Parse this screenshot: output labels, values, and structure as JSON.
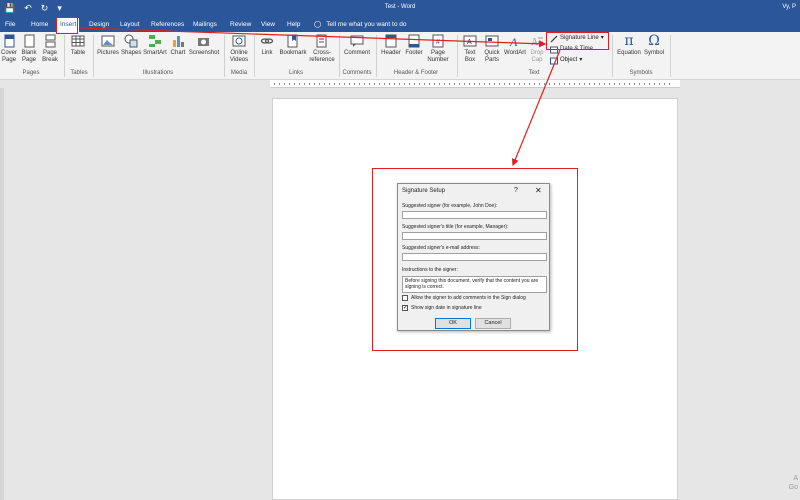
{
  "titlebar": {
    "title": "Test  -  Word",
    "user": "Vy, P"
  },
  "menu": {
    "tabs": [
      "File",
      "Home",
      "Insert",
      "Design",
      "Layout",
      "References",
      "Mailings",
      "Review",
      "View",
      "Help"
    ],
    "active_tab": "Insert",
    "tell_me": "Tell me what you want to do"
  },
  "ribbon": {
    "groups": {
      "pages": "Pages",
      "tables": "Tables",
      "illustrations": "Illustrations",
      "media": "Media",
      "links": "Links",
      "comments": "Comments",
      "header_footer": "Header & Footer",
      "text": "Text",
      "symbols": "Symbols"
    },
    "buttons": {
      "cover_page": "Cover\nPage",
      "blank_page": "Blank\nPage",
      "page_break": "Page\nBreak",
      "table": "Table",
      "pictures": "Pictures",
      "shapes": "Shapes",
      "smartart": "SmartArt",
      "chart": "Chart",
      "screenshot": "Screenshot",
      "online_videos": "Online\nVideos",
      "link": "Link",
      "bookmark": "Bookmark",
      "cross_reference": "Cross-\nreference",
      "comment": "Comment",
      "header": "Header",
      "footer": "Footer",
      "page_number": "Page\nNumber",
      "text_box": "Text\nBox",
      "quick_parts": "Quick\nParts",
      "wordart": "WordArt",
      "drop_cap": "Drop\nCap",
      "equation": "Equation",
      "symbol": "Symbol"
    },
    "small": {
      "signature_line": "Signature Line",
      "date_time": "Date & Time",
      "object": "Object"
    }
  },
  "dialog": {
    "title": "Signature Setup",
    "help": "?",
    "close": "✕",
    "suggested_signer_label": "Suggested signer (for example, John Doe):",
    "suggested_signer_value": "",
    "signer_title_label": "Suggested signer's title (for example, Manager):",
    "signer_title_value": "",
    "signer_email_label": "Suggested signer's e-mail address:",
    "signer_email_value": "",
    "instructions_label": "Instructions to the signer:",
    "instructions_value": "Before signing this document, verify that the content you are signing is correct.",
    "allow_comments_label": "Allow the signer to add comments in the Sign dialog",
    "allow_comments_checked": false,
    "show_date_label": "Show sign date in signature line",
    "show_date_checked": true,
    "ok": "OK",
    "cancel": "Cancel"
  },
  "watermark": {
    "line1": "A",
    "line2": "Go"
  },
  "colors": {
    "brand": "#2b579a",
    "highlight": "#e02020"
  }
}
